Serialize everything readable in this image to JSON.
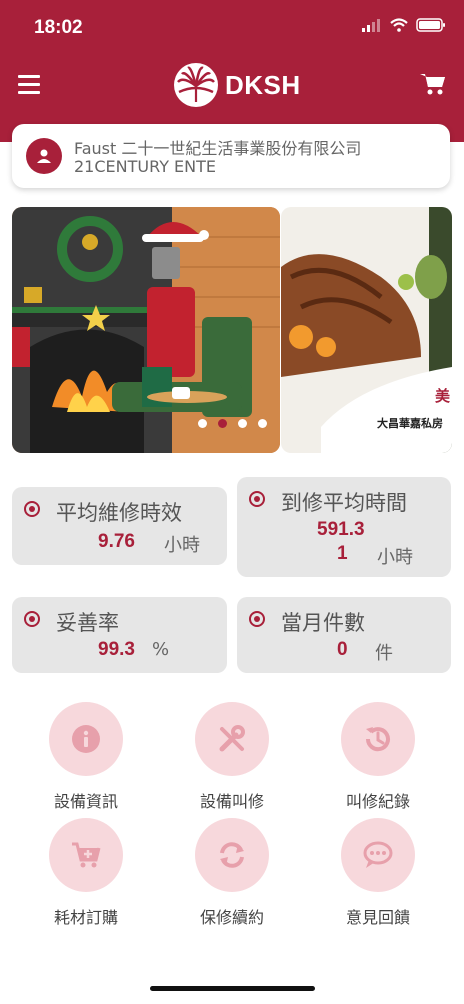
{
  "status": {
    "time": "18:02"
  },
  "header": {
    "brand": "DKSH",
    "cart_icon": "cart-icon",
    "menu_icon": "hamburger-icon"
  },
  "company": {
    "name": "Faust 二十一世紀生活事業股份有限公司",
    "sub": "21CENTURY ENTE"
  },
  "carousel": {
    "slide2_title": "美",
    "slide2_caption": "大昌華嘉私房",
    "active_dot": 1,
    "dot_count": 4
  },
  "stats": [
    {
      "label": "平均維修時效",
      "value": "9.76",
      "unit": "小時"
    },
    {
      "label": "到修平均時間",
      "value_line1": "591.3",
      "value_line2": "1",
      "unit": "小時"
    },
    {
      "label": "妥善率",
      "value": "99.3",
      "unit": "%"
    },
    {
      "label": "當月件數",
      "value": "0",
      "unit": "件"
    }
  ],
  "menu": [
    {
      "label": "設備資訊",
      "icon": "info-icon"
    },
    {
      "label": "設備叫修",
      "icon": "tools-icon"
    },
    {
      "label": "叫修紀錄",
      "icon": "history-icon"
    },
    {
      "label": "耗材訂購",
      "icon": "cart-plus-icon"
    },
    {
      "label": "保修續約",
      "icon": "refresh-icon"
    },
    {
      "label": "意見回饋",
      "icon": "chat-icon"
    }
  ],
  "colors": {
    "brand": "#a8203a",
    "menu_bg": "#f7d8dc",
    "card_bg": "#e6e6e6"
  }
}
